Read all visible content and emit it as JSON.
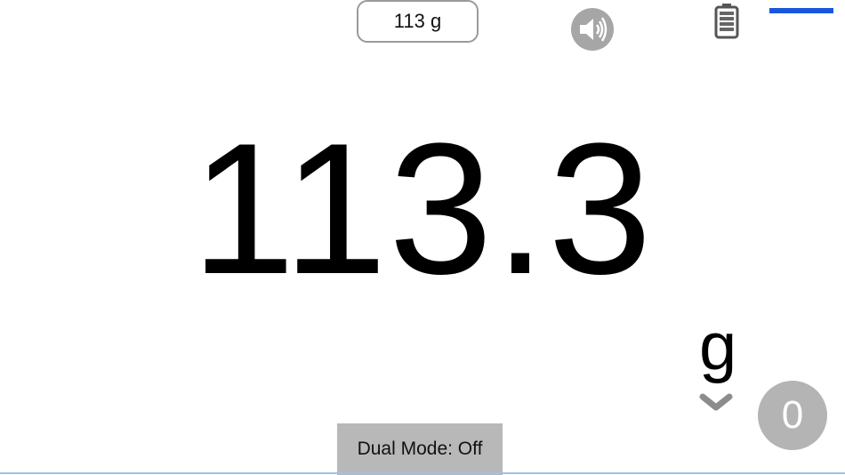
{
  "preset": {
    "label": "113 g"
  },
  "sound": {
    "icon": "speaker-icon",
    "color": "#a6a6a6"
  },
  "battery": {
    "icon": "battery-icon"
  },
  "indicator": {
    "color": "#1a56db"
  },
  "reading": {
    "value": "113.3"
  },
  "unit": {
    "label": "g",
    "dropdown_icon": "chevron-down-icon"
  },
  "tare": {
    "label": "0"
  },
  "dual_mode": {
    "label": "Dual Mode: Off"
  }
}
